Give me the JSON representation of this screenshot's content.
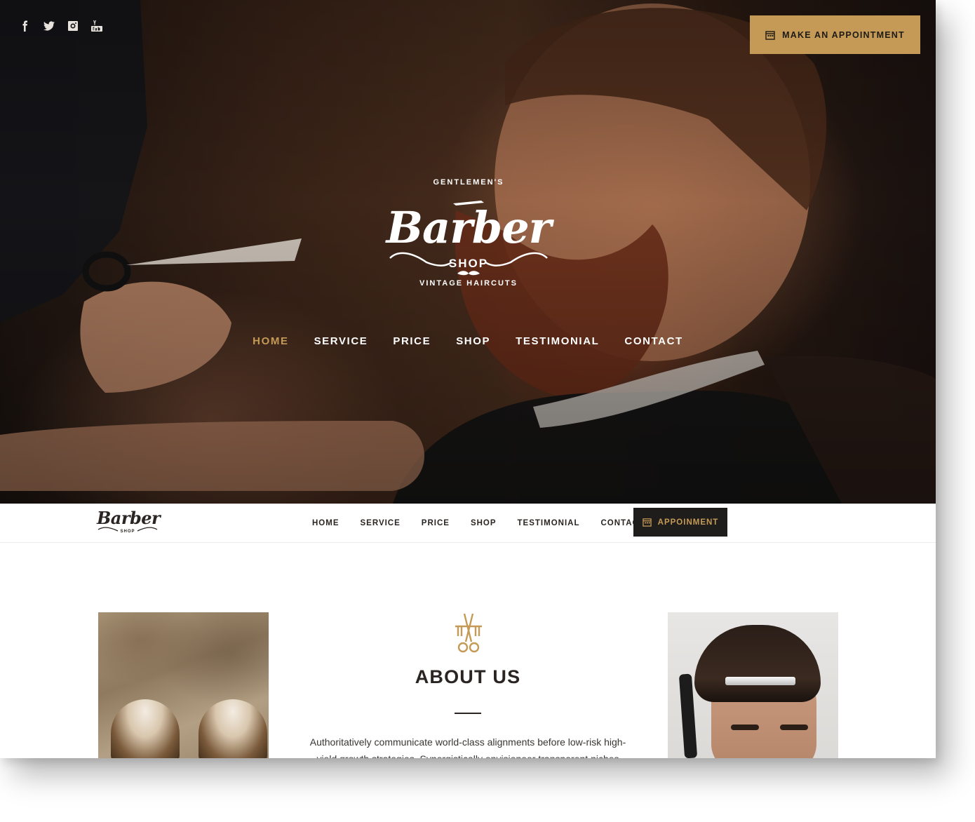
{
  "social": {
    "icons": [
      "facebook-icon",
      "twitter-icon",
      "instagram-icon",
      "youtube-icon"
    ]
  },
  "hero": {
    "appointment_label": "MAKE AN APPOINTMENT",
    "logo": {
      "top_text": "GENTLEMEN'S",
      "script_text": "Barber",
      "shop_text": "SHOP",
      "bottom_text": "VINTAGE HAIRCUTS"
    },
    "nav": [
      {
        "label": "HOME",
        "active": true
      },
      {
        "label": "SERVICE",
        "active": false
      },
      {
        "label": "PRICE",
        "active": false
      },
      {
        "label": "SHOP",
        "active": false
      },
      {
        "label": "TESTIMONIAL",
        "active": false
      },
      {
        "label": "CONTACT",
        "active": false
      }
    ]
  },
  "sticky": {
    "logo": {
      "script_text": "Barber",
      "shop_text": "SHOP"
    },
    "nav": [
      "HOME",
      "SERVICE",
      "PRICE",
      "SHOP",
      "TESTIMONIAL",
      "CONTACT"
    ],
    "appointment_label": "APPOINMENT"
  },
  "about": {
    "title": "ABOUT US",
    "text": "Authoritatively communicate world-class alignments before low-risk high-yield growth strategies. Synergistically envisioneer transparent niches after"
  },
  "colors": {
    "accent": "#c49a56",
    "dark": "#1f1d1c",
    "text": "#2a2522"
  }
}
